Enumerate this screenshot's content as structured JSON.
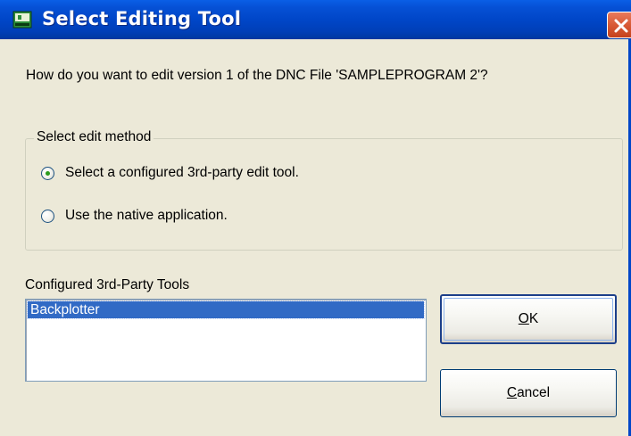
{
  "window": {
    "title": "Select Editing Tool",
    "title_icon": "dnc-app-icon",
    "close_icon": "close-icon",
    "colors": {
      "titlebar": "#0046c8",
      "face": "#ece9d8",
      "selection": "#316ac5",
      "close": "#d85a36"
    }
  },
  "question": "How do you want to edit version 1 of the DNC File 'SAMPLEPROGRAM 2'?",
  "edit_method": {
    "legend": "Select edit method",
    "options": [
      {
        "label": "Select a configured 3rd-party edit tool.",
        "checked": true
      },
      {
        "label": "Use the native application.",
        "checked": false
      }
    ]
  },
  "tools": {
    "caption": "Configured 3rd-Party Tools",
    "items": [
      "Backplotter"
    ],
    "selected_index": 0
  },
  "buttons": {
    "ok_mnemonic": "O",
    "ok_rest": "K",
    "cancel_mnemonic": "C",
    "cancel_rest": "ancel"
  }
}
